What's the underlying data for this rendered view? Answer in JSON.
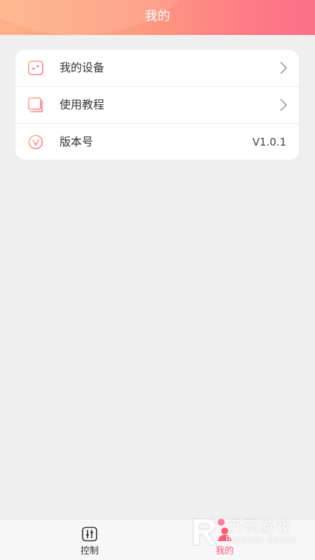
{
  "header": {
    "title": "我的"
  },
  "menu": {
    "items": [
      {
        "label": "我的设备",
        "icon": "equalizer-icon",
        "has_arrow": true
      },
      {
        "label": "使用教程",
        "icon": "book-icon",
        "has_arrow": true
      },
      {
        "label": "版本号",
        "icon": "version-icon",
        "value": "V1.0.1"
      }
    ]
  },
  "tabbar": {
    "tabs": [
      {
        "label": "控制",
        "icon": "equalizer-icon",
        "active": false
      },
      {
        "label": "我的",
        "icon": "profile-icon",
        "active": true
      }
    ]
  },
  "watermark": {
    "text_cn": "仍玩游戏",
    "text_en": "Rengwan Games"
  },
  "colors": {
    "header_gradient_start": "#fdb186",
    "header_gradient_end": "#fe6f88",
    "accent": "#ff5a78",
    "background": "#efefef"
  }
}
